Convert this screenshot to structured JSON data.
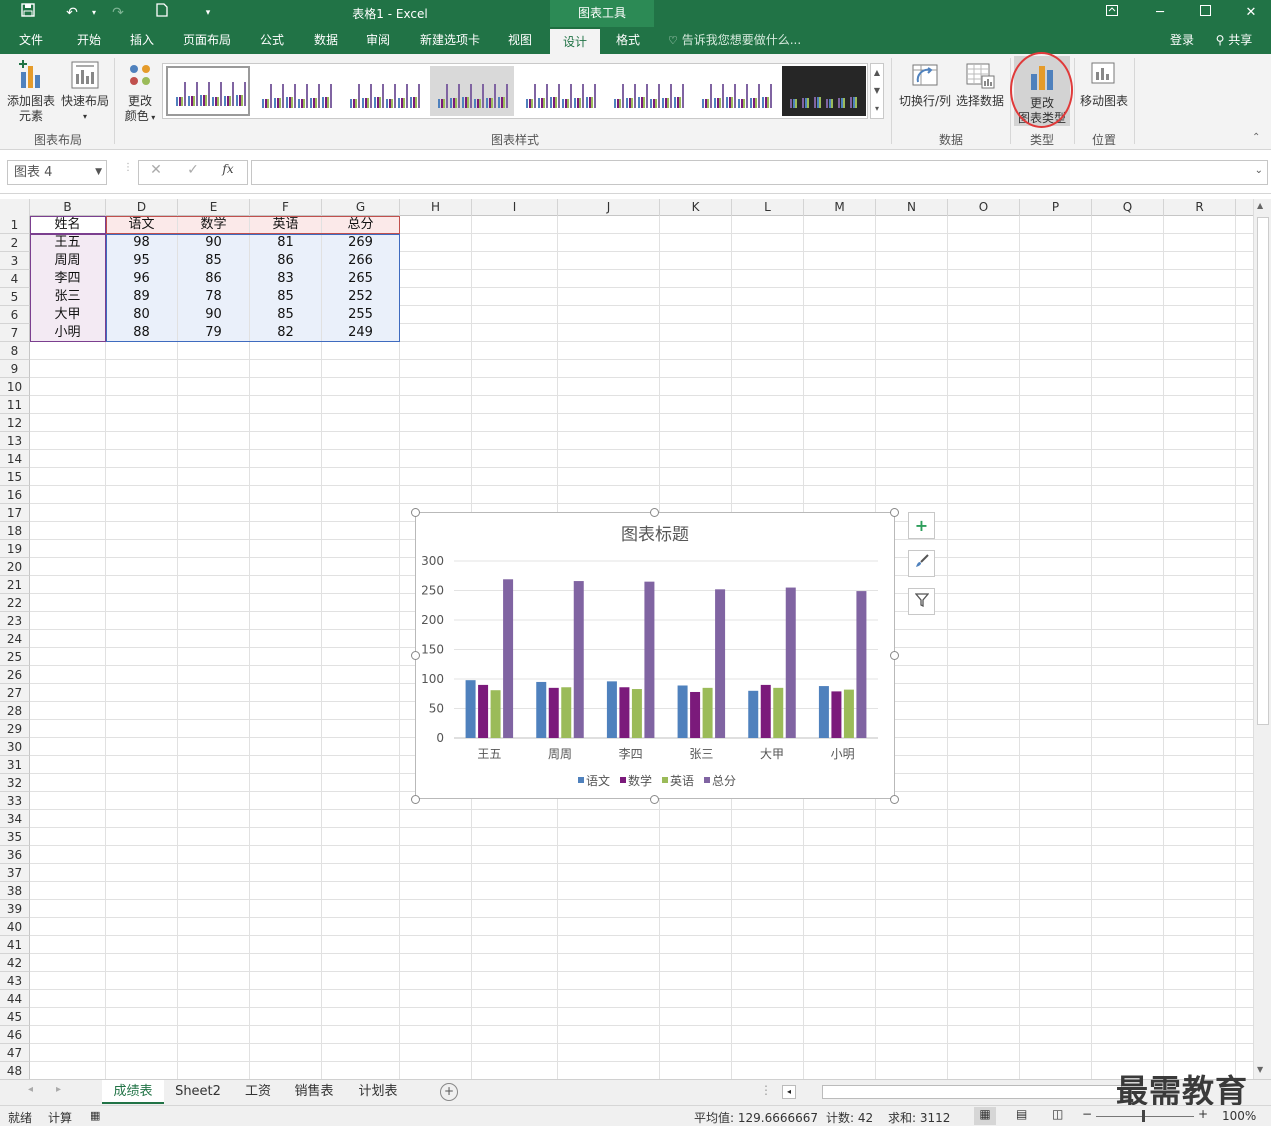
{
  "titlebar": {
    "doc_title": "表格1 - Excel",
    "tools_label": "图表工具",
    "save_icon": "save-icon",
    "undo_icon": "undo-icon",
    "redo_icon": "redo-icon",
    "new_icon": "new-doc-icon"
  },
  "tabs": [
    "文件",
    "开始",
    "插入",
    "页面布局",
    "公式",
    "数据",
    "审阅",
    "新建选项卡",
    "视图",
    "设计",
    "格式"
  ],
  "tell_me": "告诉我您想要做什么...",
  "login": "登录",
  "share": "共享",
  "ribbon": {
    "add_element": "添加图表",
    "add_element2": "元素",
    "quick_layout": "快速布局",
    "change_color": "更改",
    "change_color2": "颜色",
    "group_layout": "图表布局",
    "group_styles": "图表样式",
    "switch_rowcol": "切换行/列",
    "select_data": "选择数据",
    "group_data": "数据",
    "change_type": "更改",
    "change_type2": "图表类型",
    "group_type": "类型",
    "move_chart": "移动图表",
    "group_location": "位置"
  },
  "formula_bar": {
    "name_box": "图表 4",
    "fx": "fx",
    "cancel": "✕",
    "enter": "✓"
  },
  "columns": [
    "B",
    "D",
    "E",
    "F",
    "G",
    "H",
    "I",
    "J",
    "K",
    "L",
    "M",
    "N",
    "O",
    "P",
    "Q",
    "R"
  ],
  "table": {
    "headers": [
      "姓名",
      "语文",
      "数学",
      "英语",
      "总分"
    ],
    "rows": [
      [
        "王五",
        "98",
        "90",
        "81",
        "269"
      ],
      [
        "周周",
        "95",
        "85",
        "86",
        "266"
      ],
      [
        "李四",
        "96",
        "86",
        "83",
        "265"
      ],
      [
        "张三",
        "89",
        "78",
        "85",
        "252"
      ],
      [
        "大甲",
        "80",
        "90",
        "85",
        "255"
      ],
      [
        "小明",
        "88",
        "79",
        "82",
        "249"
      ]
    ]
  },
  "chart_data": {
    "type": "bar",
    "title": "图表标题",
    "categories": [
      "王五",
      "周周",
      "李四",
      "张三",
      "大甲",
      "小明"
    ],
    "series": [
      {
        "name": "语文",
        "color": "#4f81bd",
        "values": [
          98,
          95,
          96,
          89,
          80,
          88
        ]
      },
      {
        "name": "数学",
        "color": "#7b1a7b",
        "values": [
          90,
          85,
          86,
          78,
          90,
          79
        ]
      },
      {
        "name": "英语",
        "color": "#9bbb59",
        "values": [
          81,
          86,
          83,
          85,
          85,
          82
        ]
      },
      {
        "name": "总分",
        "color": "#8064a2",
        "values": [
          269,
          266,
          265,
          252,
          255,
          249
        ]
      }
    ],
    "yticks": [
      "0",
      "50",
      "100",
      "150",
      "200",
      "250",
      "300"
    ],
    "ylim": [
      0,
      300
    ],
    "legend": "bottom",
    "grid": true
  },
  "sheets": [
    "成绩表",
    "Sheet2",
    "工资",
    "销售表",
    "计划表"
  ],
  "status": {
    "ready": "就绪",
    "calc": "计算",
    "average": "平均值: 129.6666667",
    "count": "计数: 42",
    "sum": "求和: 3112",
    "zoom": "100%"
  },
  "watermark": "最需教育"
}
